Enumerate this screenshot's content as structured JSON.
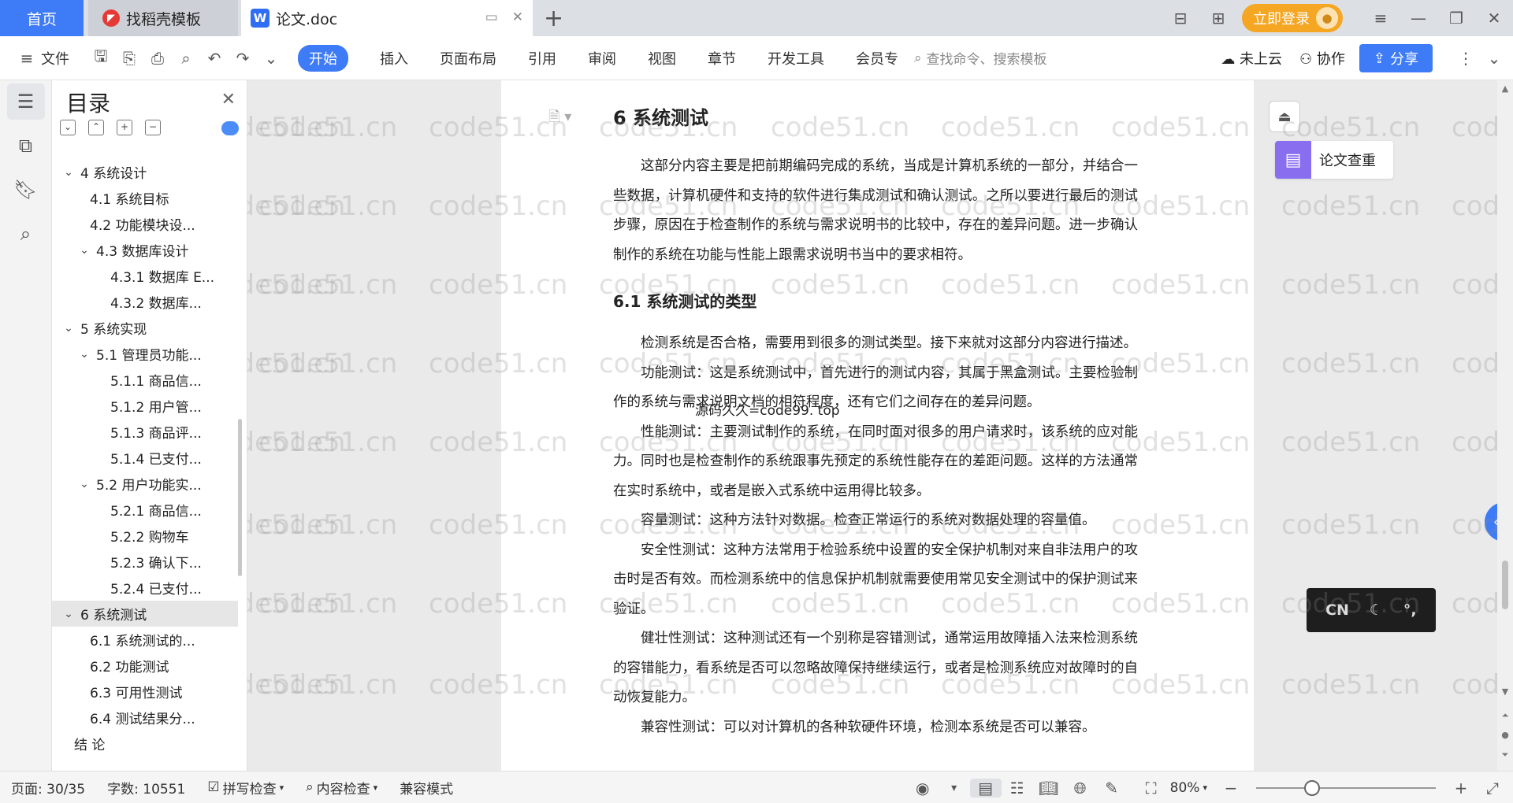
{
  "titlebar": {
    "tabs": [
      {
        "label": "首页"
      },
      {
        "label": "找稻壳模板",
        "icon": "daoke-icon"
      },
      {
        "label": "论文.doc",
        "icon": "wps-writer-icon"
      }
    ],
    "login_label": "立即登录",
    "accent": "#3e7bf6",
    "login_color": "#f5a623"
  },
  "menubar": {
    "file_label": "文件",
    "items": [
      "开始",
      "插入",
      "页面布局",
      "引用",
      "审阅",
      "视图",
      "章节",
      "开发工具",
      "会员专"
    ],
    "active_item": "开始",
    "search_placeholder": "查找命令、搜索模板",
    "cloud_label": "未上云",
    "collab_label": "协作",
    "share_label": "分享"
  },
  "toc": {
    "title": "目录",
    "items": [
      {
        "label": "4 系统设计",
        "level": 1,
        "chevron": true
      },
      {
        "label": "4.1 系统目标",
        "level": 2
      },
      {
        "label": "4.2 功能模块设...",
        "level": 2
      },
      {
        "label": "4.3 数据库设计",
        "level": 2,
        "chevron": true
      },
      {
        "label": "4.3.1 数据库 E...",
        "level": 3
      },
      {
        "label": "4.3.2 数据库...",
        "level": 3
      },
      {
        "label": "5 系统实现",
        "level": 1,
        "chevron": true
      },
      {
        "label": "5.1 管理员功能...",
        "level": 2,
        "chevron": true
      },
      {
        "label": "5.1.1 商品信...",
        "level": 3
      },
      {
        "label": "5.1.2 用户管...",
        "level": 3
      },
      {
        "label": "5.1.3 商品评...",
        "level": 3
      },
      {
        "label": "5.1.4 已支付...",
        "level": 3
      },
      {
        "label": "5.2 用户功能实...",
        "level": 2,
        "chevron": true
      },
      {
        "label": "5.2.1 商品信...",
        "level": 3
      },
      {
        "label": "5.2.2 购物车",
        "level": 3
      },
      {
        "label": "5.2.3 确认下...",
        "level": 3
      },
      {
        "label": "5.2.4 已支付...",
        "level": 3
      },
      {
        "label": "6 系统测试",
        "level": 1,
        "chevron": true,
        "selected": true
      },
      {
        "label": "6.1 系统测试的...",
        "level": 2
      },
      {
        "label": "6.2 功能测试",
        "level": 2
      },
      {
        "label": "6.3 可用性测试",
        "level": 2
      },
      {
        "label": "6.4 测试结果分...",
        "level": 2
      },
      {
        "label": "结 论",
        "level": 1
      }
    ]
  },
  "document": {
    "heading": "6 系统测试",
    "intro": "这部分内容主要是把前期编码完成的系统，当成是计算机系统的一部分，并结合一些数据，计算机硬件和支持的软件进行集成测试和确认测试。之所以要进行最后的测试步骤，原因在于检查制作的系统与需求说明书的比较中，存在的差异问题。进一步确认制作的系统在功能与性能上跟需求说明书当中的要求相符。",
    "section_heading": "6.1  系统测试的类型",
    "paragraphs": [
      "检测系统是否合格，需要用到很多的测试类型。接下来就对这部分内容进行描述。",
      "功能测试：这是系统测试中，首先进行的测试内容，其属于黑盒测试。主要检验制作的系统与需求说明文档的相符程度，还有它们之间存在的差异问题。",
      "性能测试：主要测试制作的系统，在同时面对很多的用户请求时，该系统的应对能力。同时也是检查制作的系统跟事先预定的系统性能存在的差距问题。这样的方法通常在实时系统中，或者是嵌入式系统中运用得比较多。",
      "容量测试：这种方法针对数据。检查正常运行的系统对数据处理的容量值。",
      "安全性测试：这种方法常用于检验系统中设置的安全保护机制对来自非法用户的攻击时是否有效。而检测系统中的信息保护机制就需要使用常见安全测试中的保护测试来验证。",
      "健壮性测试：这种测试还有一个别称是容错测试，通常运用故障插入法来检测系统的容错能力，看系统是否可以忽略故障保持继续运行，或者是检测系统应对故障时的自动恢复能力。",
      "兼容性测试：可以对计算机的各种软硬件环境，检测本系统是否可以兼容。"
    ],
    "floating_note": "源码久久=code99. top"
  },
  "side": {
    "plagiarism_label": "论文查重",
    "ime_text": "CN"
  },
  "watermark": "code51.cn",
  "statusbar": {
    "page_label": "页面: 30/35",
    "word_label": "字数: 10551",
    "spell_label": "拼写检查",
    "content_label": "内容检查",
    "compat_label": "兼容模式",
    "zoom_label": "80%",
    "zoom_value": 0.8
  }
}
